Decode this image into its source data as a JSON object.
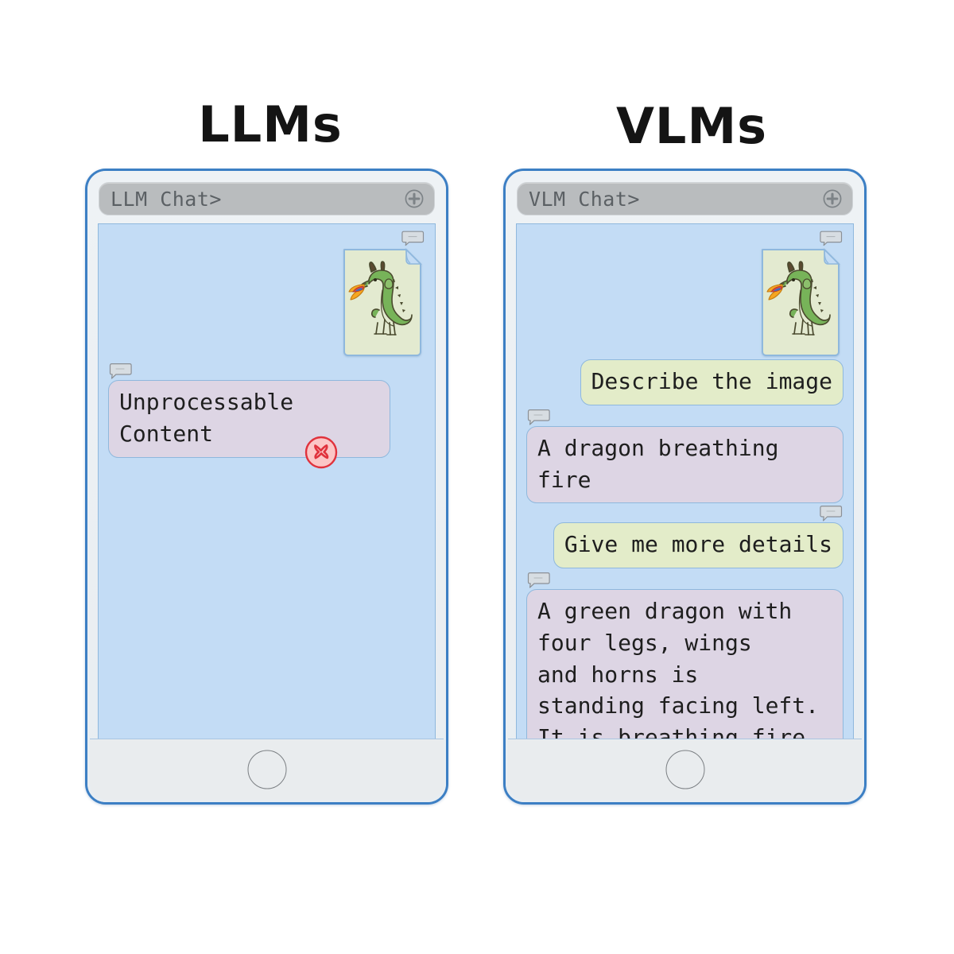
{
  "columns": [
    {
      "key": "llm",
      "title": "LLMs",
      "phone": {
        "titlebar_label": "LLM Chat>",
        "plus_icon": "plus-circle-icon",
        "home_button": "home-button"
      },
      "messages": [
        {
          "sender": "user",
          "type": "image",
          "marker": "speech-bubble-icon",
          "alt": "dragon breathing fire illustration"
        },
        {
          "sender": "assistant",
          "type": "error",
          "marker": "speech-bubble-icon",
          "text": "Unprocessable\nContent",
          "icon": "error-x-icon"
        }
      ]
    },
    {
      "key": "vlm",
      "title": "VLMs",
      "phone": {
        "titlebar_label": "VLM Chat>",
        "plus_icon": "plus-circle-icon",
        "home_button": "home-button"
      },
      "messages": [
        {
          "sender": "user",
          "type": "image",
          "marker": "speech-bubble-icon",
          "alt": "dragon breathing fire illustration"
        },
        {
          "sender": "user",
          "type": "text",
          "text": "Describe the image"
        },
        {
          "sender": "assistant",
          "type": "text",
          "marker": "speech-bubble-icon",
          "text": "A dragon breathing\nfire"
        },
        {
          "sender": "user",
          "type": "text",
          "marker": "speech-bubble-icon",
          "text": "Give me more details"
        },
        {
          "sender": "assistant",
          "type": "text",
          "marker": "speech-bubble-icon",
          "text": "A green dragon with\nfour legs, wings\nand horns is\nstanding facing left.\nIt is breathing fire."
        }
      ]
    }
  ],
  "colors": {
    "background": "#ffffff",
    "phone_border": "#3c7fc4",
    "screen": "#c3dcf5",
    "titlebar": "#b9bcbe",
    "bubble_assistant": "#ddd5e4",
    "bubble_user": "#e3ecc9",
    "bubble_border": "#8fb8dd",
    "bezel": "#e9ecee",
    "error_red": "#e0323c",
    "dragon_green": "#77b359",
    "image_card": "#e3ead0"
  }
}
